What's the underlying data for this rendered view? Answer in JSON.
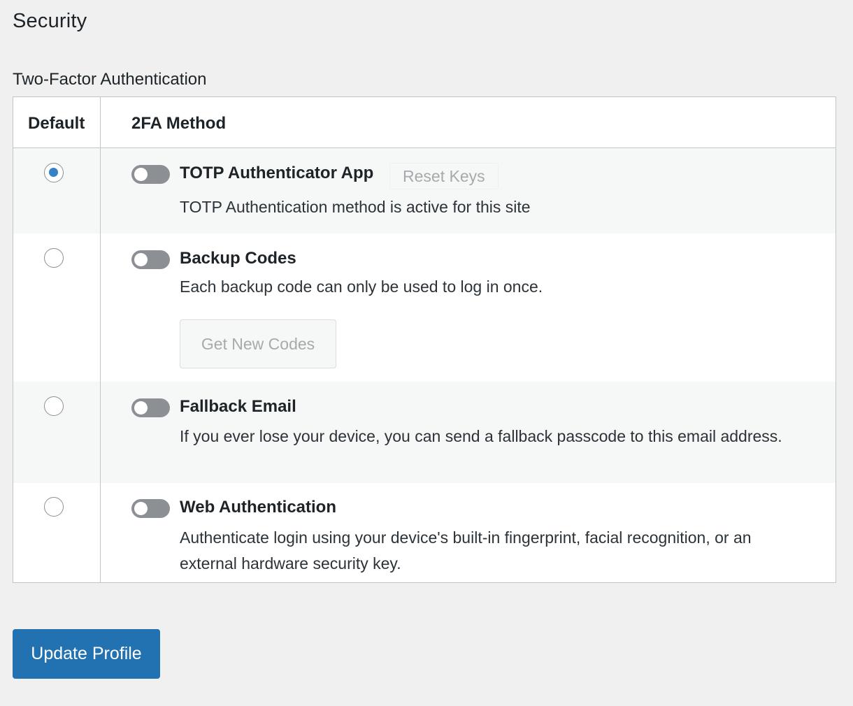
{
  "page": {
    "section_title": "Security",
    "subsection_title": "Two-Factor Authentication"
  },
  "table": {
    "headers": {
      "default": "Default",
      "method": "2FA Method"
    },
    "rows": [
      {
        "title": "TOTP Authenticator App",
        "description": "TOTP Authentication method is active for this site",
        "default_selected": true,
        "enabled": false,
        "action_label": "Reset Keys"
      },
      {
        "title": "Backup Codes",
        "description": "Each backup code can only be used to log in once.",
        "default_selected": false,
        "enabled": false,
        "action_label": "Get New Codes"
      },
      {
        "title": "Fallback Email",
        "description": "If you ever lose your device, you can send a fallback passcode to this email address.",
        "default_selected": false,
        "enabled": false
      },
      {
        "title": "Web Authentication",
        "description": "Authenticate login using your device's built-in fingerprint, facial recognition, or an external hardware security key.",
        "default_selected": false,
        "enabled": false
      }
    ]
  },
  "footer": {
    "submit_label": "Update Profile"
  },
  "colors": {
    "accent": "#2271b1",
    "radio_checked": "#3582c4",
    "toggle_off": "#8c8f94",
    "page_bg": "#f0f0f1"
  }
}
